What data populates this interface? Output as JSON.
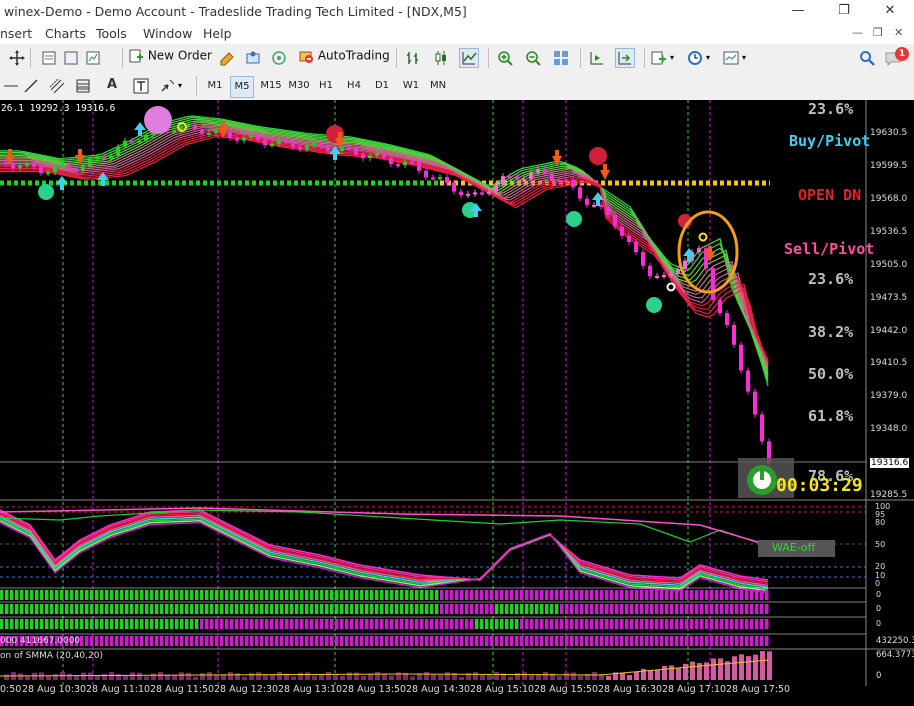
{
  "title": "winex-Demo - Demo Account - Tradeslide Trading Tech Limited - [NDX,M5]",
  "window_controls": {
    "minimize": "—",
    "restore": "❐",
    "close": "✕"
  },
  "menu": [
    "nsert",
    "Charts",
    "Tools",
    "Window",
    "Help"
  ],
  "toolbar": {
    "new_order": "New Order",
    "auto_trading": "AutoTrading",
    "notif_count": "1"
  },
  "timeframes": [
    "M1",
    "M5",
    "M15",
    "M30",
    "H1",
    "H4",
    "D1",
    "W1",
    "MN"
  ],
  "active_timeframe": "M5",
  "chart": {
    "ohlc_header": "26.1 19292.3 19316.6",
    "fib_labels": [
      {
        "text": "23.6%",
        "color": "#bfbfbf"
      },
      {
        "text": "Buy/Pivot",
        "color": "#3fd0f0"
      },
      {
        "text": "OPEN DN",
        "color": "#e0202a"
      },
      {
        "text": "Sell/Pivot",
        "color": "#ff4fa0"
      },
      {
        "text": "23.6%",
        "color": "#bfbfbf"
      },
      {
        "text": "38.2%",
        "color": "#bfbfbf"
      },
      {
        "text": "50.0%",
        "color": "#bfbfbf"
      },
      {
        "text": "61.8%",
        "color": "#bfbfbf"
      },
      {
        "text": "78.6%",
        "color": "#bfbfbf"
      }
    ],
    "countdown": "00:03:29",
    "current_price": "19316.6",
    "price_axis": [
      "19630.5",
      "19599.5",
      "19568.0",
      "19536.5",
      "19505.0",
      "19473.5",
      "19442.0",
      "19410.5",
      "19379.0",
      "19348.0",
      "19316.6",
      "19285.5"
    ],
    "osc_axis": [
      "100",
      "95",
      "80",
      "50",
      "20",
      "10",
      "0"
    ],
    "wae_label": "WAE-off",
    "sub_values": [
      "0",
      "0",
      "0"
    ],
    "lower_left": "000 411667.0000",
    "lower_right": "432250.3",
    "smma_label": "on of SMMA (20,40,20)",
    "smma_value": "664.3773",
    "smma_zero": "0",
    "time_axis": [
      "0:50",
      "28 Aug 10:30",
      "28 Aug 11:10",
      "28 Aug 11:50",
      "28 Aug 12:30",
      "28 Aug 13:10",
      "28 Aug 13:50",
      "28 Aug 14:30",
      "28 Aug 15:10",
      "28 Aug 15:50",
      "28 Aug 16:30",
      "28 Aug 17:10",
      "28 Aug 17:50"
    ]
  }
}
